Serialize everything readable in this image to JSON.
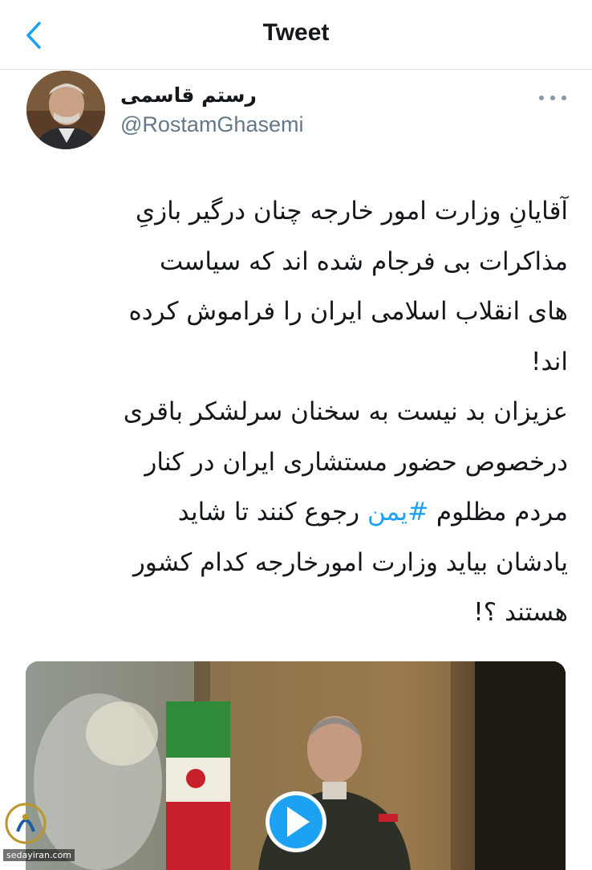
{
  "header": {
    "title": "Tweet",
    "back_icon": "chevron-left-icon"
  },
  "author": {
    "name": "رستم قاسمی",
    "handle": "@RostamGhasemi",
    "avatar": "profile-photo"
  },
  "tweet": {
    "lines": [
      "آقایانِ وزارت امور خارجه چنان درگیر بازیِ",
      "مذاکرات بی فرجام شده اند که سیاست",
      "های انقلاب اسلامی ایران را فراموش کرده",
      "اند!",
      "عزیزان بد نیست به سخنان سرلشکر باقری",
      "درخصوص حضور مستشاری ایران در کنار"
    ],
    "line7_before": "مردم مظلوم ",
    "hashtag": "#یمن",
    "line7_after": " رجوع کنند تا شاید",
    "lines_end": [
      "یادشان بیاید وزارت امورخارجه کدام کشور",
      "هستند ؟!"
    ]
  },
  "media": {
    "type": "video",
    "play_icon": "play-icon"
  },
  "watermark": {
    "text": "sedayiran.com"
  },
  "colors": {
    "accent": "#1da1f2",
    "text": "#14171a",
    "secondary": "#657786",
    "divider": "#dfe3e8"
  }
}
